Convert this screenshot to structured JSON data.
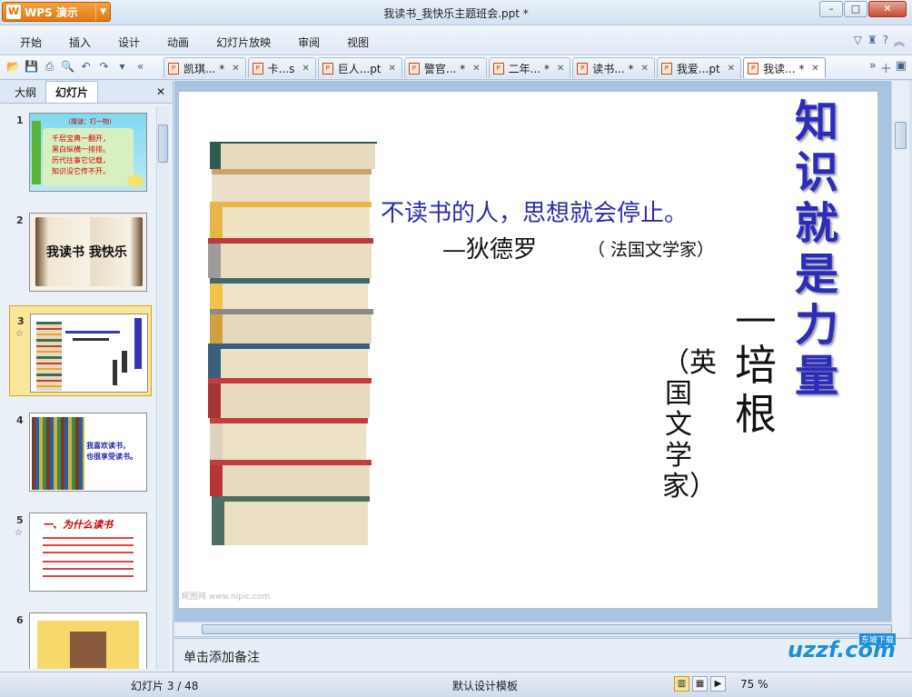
{
  "app": {
    "name": "WPS 演示",
    "window_title": "我读书_我快乐主题班会.ppt *"
  },
  "menu": {
    "items": [
      "开始",
      "插入",
      "设计",
      "动画",
      "幻灯片放映",
      "审阅",
      "视图"
    ]
  },
  "tabs": [
    {
      "label": "凯琪... *",
      "active": false
    },
    {
      "label": "卡...s",
      "active": false
    },
    {
      "label": "巨人...pt",
      "active": false
    },
    {
      "label": "警官... *",
      "active": false
    },
    {
      "label": "二年... *",
      "active": false
    },
    {
      "label": "读书... *",
      "active": false
    },
    {
      "label": "我爱...pt",
      "active": false
    },
    {
      "label": "我读... *",
      "active": true
    }
  ],
  "left_panel": {
    "tab_outline": "大纲",
    "tab_slides": "幻灯片",
    "slides": [
      {
        "number": "1",
        "lines": [
          "（猜谜：打一物）",
          "千层宝典一翻开，",
          "黑白纵横一排排。",
          "历代往事它记载，",
          "知识没它传不开。"
        ]
      },
      {
        "number": "2",
        "title": "我读书 我快乐"
      },
      {
        "number": "3",
        "star": "☆",
        "selected": true
      },
      {
        "number": "4",
        "lines": [
          "我喜欢读书，",
          "也很享受读书。"
        ]
      },
      {
        "number": "5",
        "star": "☆",
        "title": "一、为什么读书"
      },
      {
        "number": "6"
      }
    ]
  },
  "slide": {
    "quote1": "不读书的人，思想就会停止。",
    "quote1_author": "—狄德罗",
    "quote1_origin": "（ 法国文学家）",
    "title": "知识就是力量",
    "bacon": "—培根",
    "bacon_origin": "（英国文学家）",
    "watermark": "昵图网 www.nipic.com"
  },
  "notes": {
    "placeholder": "单击添加备注"
  },
  "status": {
    "slide_info": "幻灯片 3 / 48",
    "template": "默认设计模板",
    "zoom": "75 %"
  },
  "brand": {
    "watermark": "uzzf.com",
    "sub": "东坡下载"
  }
}
